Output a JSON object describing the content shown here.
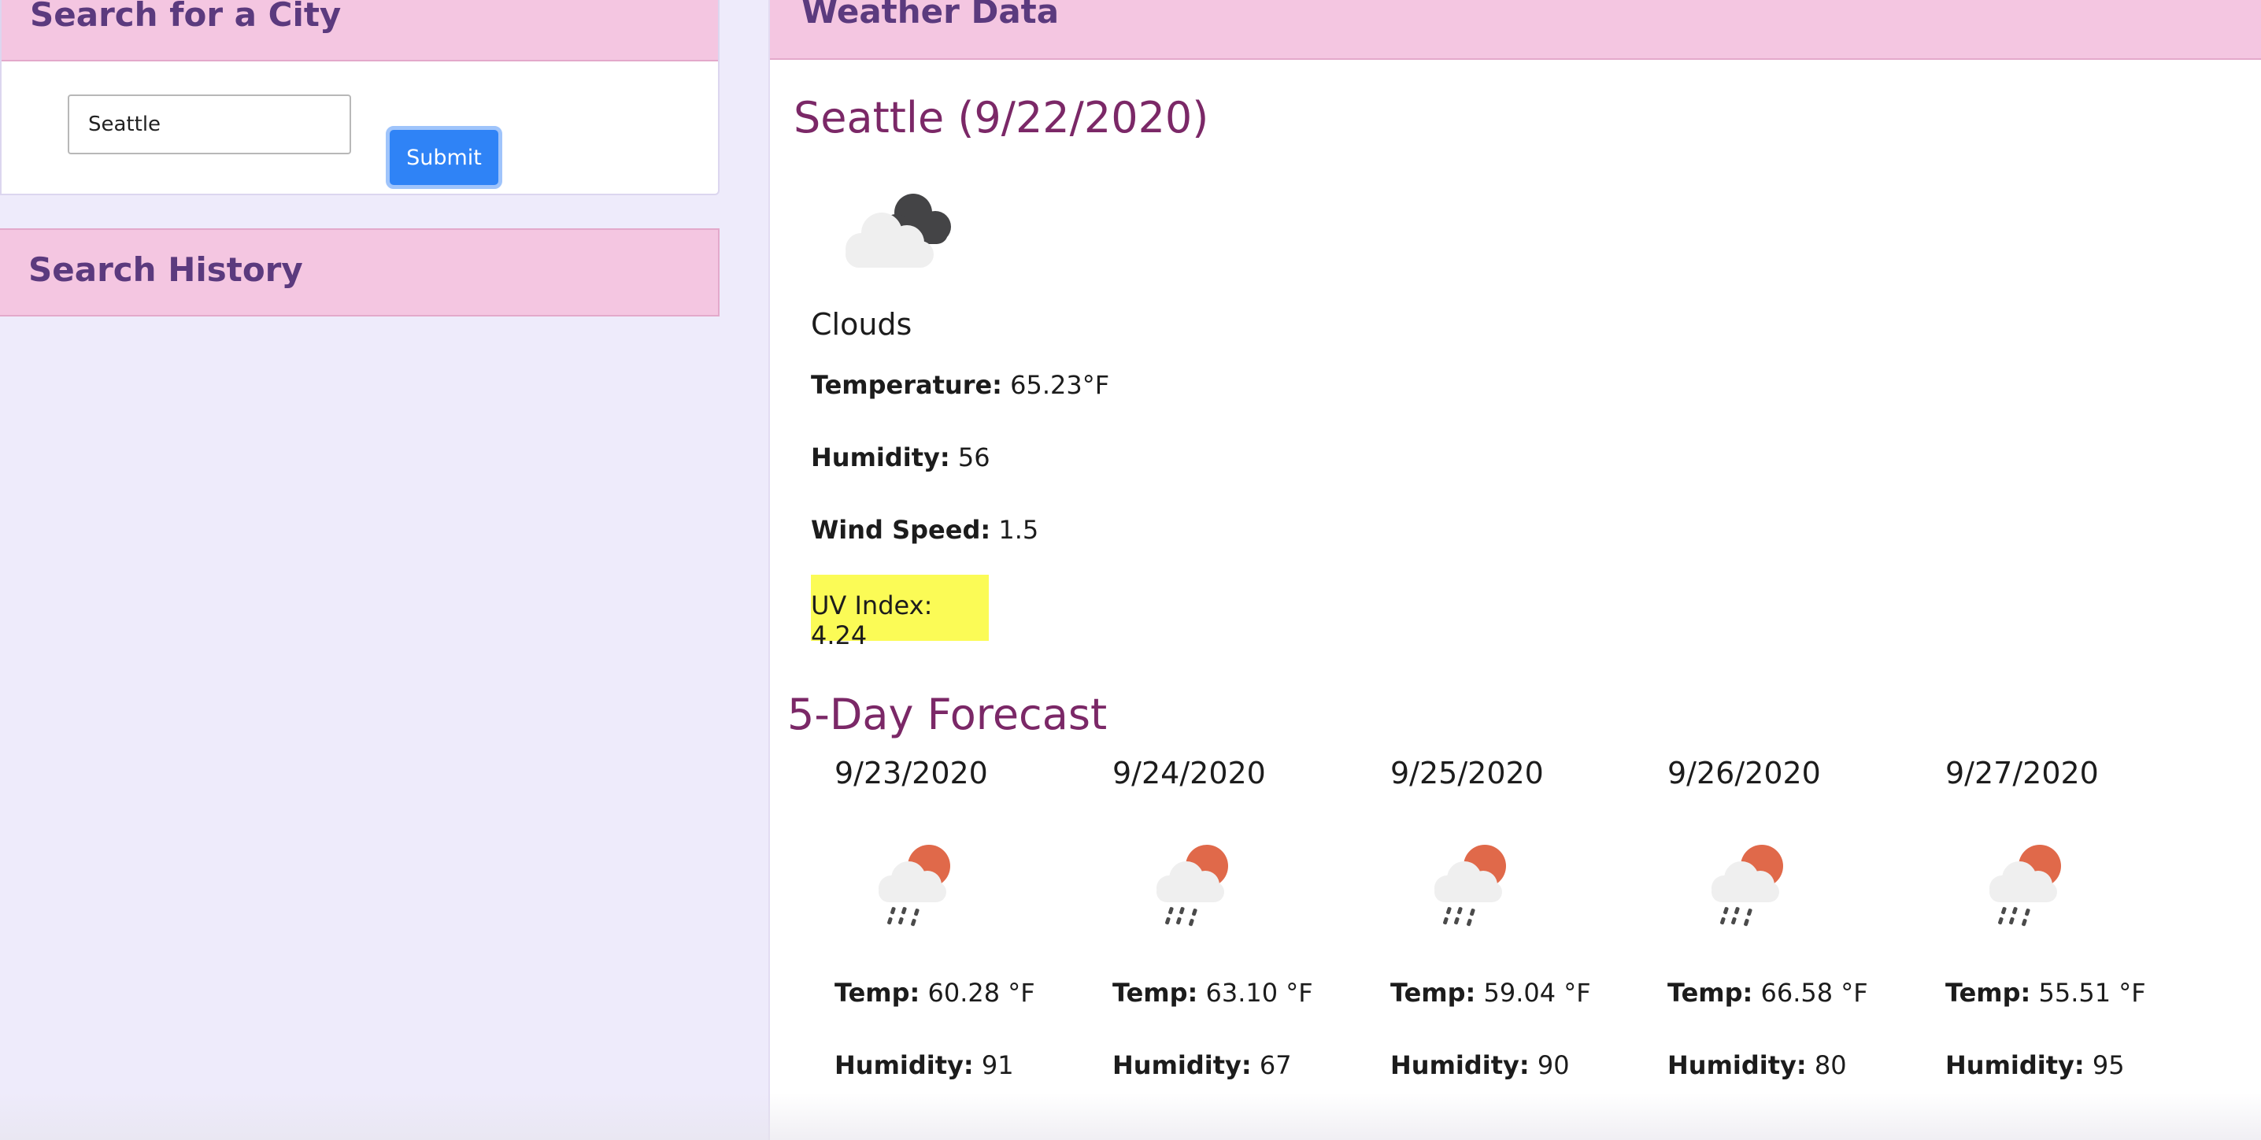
{
  "search": {
    "title": "Search for a City",
    "input_value": "Seattle",
    "submit_label": "Submit"
  },
  "history": {
    "title": "Search History"
  },
  "weather": {
    "panel_title": "Weather Data",
    "city_heading": "Seattle (9/22/2020)",
    "icon": "cloud-dark-icon",
    "condition": "Clouds",
    "temperature_label": "Temperature:",
    "temperature_value": "65.23°F",
    "humidity_label": "Humidity:",
    "humidity_value": "56",
    "wind_label": "Wind Speed:",
    "wind_value": "1.5",
    "uv_label": "UV Index:",
    "uv_value": "4.24",
    "uv_color": "#fbfb56"
  },
  "forecast": {
    "title": "5-Day Forecast",
    "temp_label": "Temp:",
    "humidity_label": "Humidity:",
    "days": [
      {
        "date": "9/23/2020",
        "icon": "rain-sun-cloud-icon",
        "temp": "60.28 °F",
        "humidity": "91"
      },
      {
        "date": "9/24/2020",
        "icon": "rain-sun-cloud-icon",
        "temp": "63.10 °F",
        "humidity": "67"
      },
      {
        "date": "9/25/2020",
        "icon": "rain-sun-cloud-icon",
        "temp": "59.04 °F",
        "humidity": "90"
      },
      {
        "date": "9/26/2020",
        "icon": "rain-sun-cloud-icon",
        "temp": "66.58 °F",
        "humidity": "80"
      },
      {
        "date": "9/27/2020",
        "icon": "rain-sun-cloud-icon",
        "temp": "55.51 °F",
        "humidity": "95"
      }
    ]
  },
  "colors": {
    "header_pink": "#f4c6e1",
    "header_text": "#5b3a7e",
    "title_purple": "#7b2867",
    "page_background": "#eeebfb",
    "submit_blue": "#2f83f6"
  }
}
